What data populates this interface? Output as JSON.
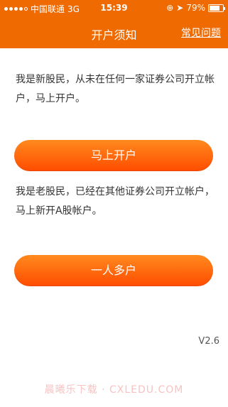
{
  "status_bar": {
    "carrier": "中国联通",
    "network": "3G",
    "time": "15:39",
    "battery_percent_text": "79%"
  },
  "nav": {
    "title": "开户须知",
    "faq_label": "常见问题"
  },
  "sections": [
    {
      "text": "我是新股民，从未在任何一家证券公司开立帐户，马上开户。",
      "button_label": "马上开户"
    },
    {
      "text": "我是老股民，已经在其他证券公司开立帐户，马上新开A股帐户。",
      "button_label": "一人多户"
    }
  ],
  "version": "V2.6",
  "watermark": "晨曦乐下载 · CXLEDU.COM",
  "colors": {
    "brand_orange": "#ef6a00",
    "button_top": "#ff8a1e",
    "button_bottom": "#ff4c00"
  }
}
